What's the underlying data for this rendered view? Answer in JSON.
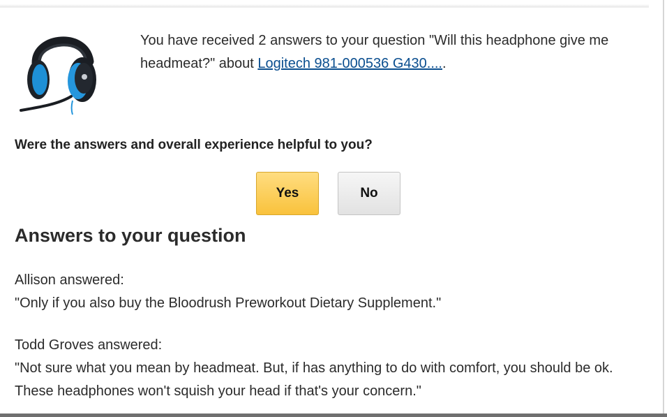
{
  "email": {
    "intro_prefix": "You have received 2 answers to your question \"Will this headphone give me headmeat?\" about ",
    "product_link_text": "Logitech 981-000536 G430....",
    "intro_suffix": ".",
    "product_image_name": "headset-image",
    "helpful_question": "Were the answers and overall experience helpful to you?",
    "yes_label": "Yes",
    "no_label": "No",
    "section_heading": "Answers to your question",
    "answers": [
      {
        "author_line": "Allison answered:",
        "text": "\"Only if you also buy the Bloodrush Preworkout Dietary Supplement.\""
      },
      {
        "author_line": "Todd Groves answered:",
        "text": "\"Not sure what you mean by headmeat. But, if has anything to do with comfort, you should be ok. These headphones won't squish your head if that's your concern.\""
      }
    ]
  },
  "colors": {
    "link": "#0a4e8f",
    "yes_button": "#f9c23c",
    "no_button": "#e2e2e2",
    "text": "#2b2b2b"
  }
}
